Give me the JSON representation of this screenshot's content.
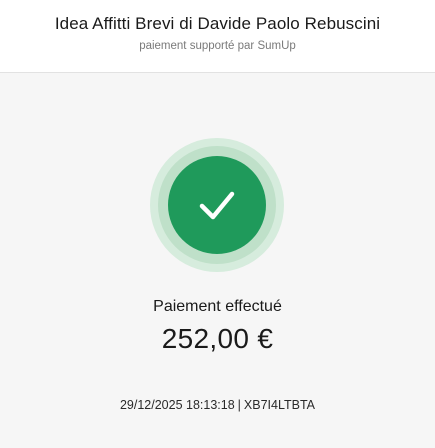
{
  "header": {
    "merchant_name": "Idea Affitti Brevi di Davide Paolo Rebuscini",
    "powered_by": "paiement supporté par SumUp"
  },
  "status": {
    "icon": "checkmark-icon",
    "title": "Paiement effectué",
    "color": "#1f9a5b"
  },
  "payment": {
    "amount": "252,00 €"
  },
  "transaction": {
    "timestamp": "29/12/2025 18:13:18",
    "separator": "|",
    "code": "XB7I4LTBTA"
  }
}
